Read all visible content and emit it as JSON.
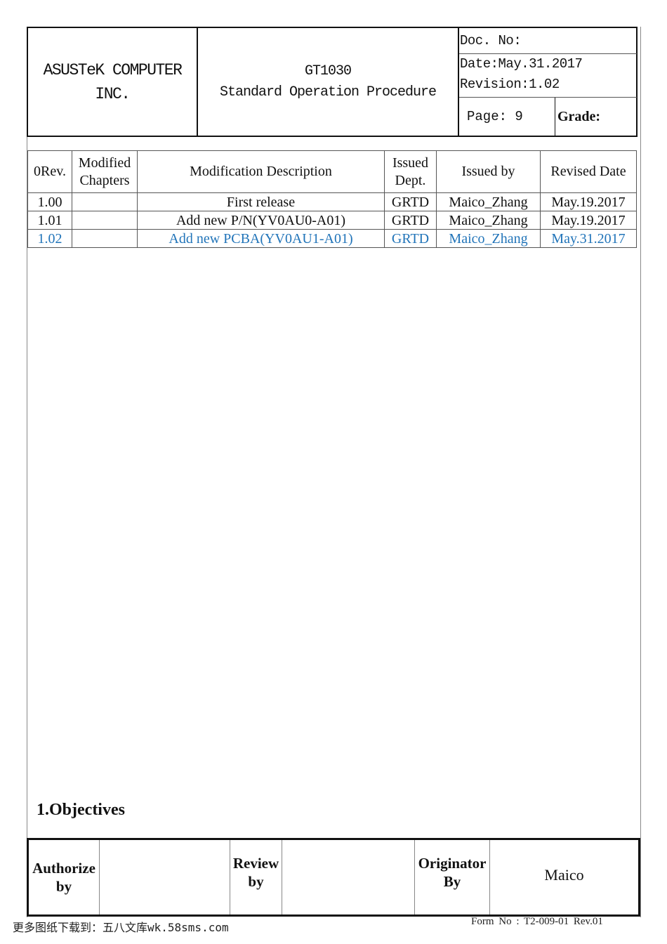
{
  "header": {
    "company_line1": "ASUSTeK COMPUTER",
    "company_line2": "INC.",
    "product": "GT1030",
    "doc_type": "Standard Operation Procedure",
    "doc_no": "Doc. No:",
    "date": "Date:May.31.2017",
    "revision": "Revision:1.02",
    "page": "Page: 9",
    "grade": "Grade:"
  },
  "revision_table": {
    "columns": [
      "0Rev.",
      "Modified Chapters",
      "Modification Description",
      "Issued Dept.",
      "Issued by",
      "Revised Date"
    ],
    "column_lines": {
      "modified_1": "Modified",
      "modified_2": "Chapters",
      "issued_dept_1": "Issued",
      "issued_dept_2": "Dept."
    },
    "rows": [
      {
        "rev": "1.00",
        "chapters": "",
        "description": "First release",
        "dept": "GRTD",
        "issued_by": "Maico_Zhang",
        "date": "May.19.2017"
      },
      {
        "rev": "1.01",
        "chapters": "",
        "description": "Add new P/N(YV0AU0-A01)",
        "dept": "GRTD",
        "issued_by": "Maico_Zhang",
        "date": "May.19.2017"
      },
      {
        "rev": "1.02",
        "chapters": "",
        "description": "Add new PCBA(YV0AU1-A01)",
        "dept": "GRTD",
        "issued_by": "Maico_Zhang",
        "date": "May.31.2017"
      }
    ],
    "highlight_color": "#2174b9"
  },
  "section": {
    "objectives_heading": "1.Objectives"
  },
  "signoff": {
    "authorize_1": "Authorize",
    "authorize_2": "by",
    "authorize_value": "",
    "review_1": "Review",
    "review_2": "by",
    "review_value": "",
    "originator_1": "Originator",
    "originator_2": "By",
    "originator_value": "Maico"
  },
  "footer": {
    "download_note": "更多图纸下载到：五八文库wk.58sms.com",
    "form_no": "Form No : T2-009-01 Rev.01"
  }
}
